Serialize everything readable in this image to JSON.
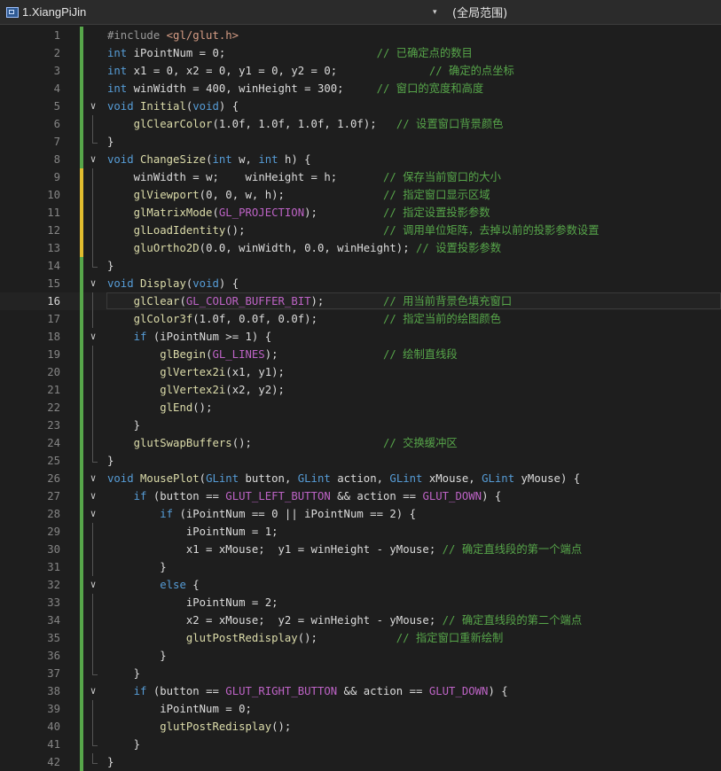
{
  "topbar": {
    "project": "1.XiangPiJin",
    "scope": "(全局范围)"
  },
  "editor": {
    "current_line": 16,
    "lines": [
      {
        "n": "1",
        "t": "#include <gl/glut.h>"
      },
      {
        "n": "2",
        "t": "int iPointNum = 0;                       // 已确定点的数目"
      },
      {
        "n": "3",
        "t": "int x1 = 0, x2 = 0, y1 = 0, y2 = 0;              // 确定的点坐标"
      },
      {
        "n": "4",
        "t": "int winWidth = 400, winHeight = 300;     // 窗口的宽度和高度"
      },
      {
        "n": "5",
        "t": "void Initial(void) {"
      },
      {
        "n": "6",
        "t": "    glClearColor(1.0f, 1.0f, 1.0f, 1.0f);   // 设置窗口背景颜色"
      },
      {
        "n": "7",
        "t": "}"
      },
      {
        "n": "8",
        "t": "void ChangeSize(int w, int h) {"
      },
      {
        "n": "9",
        "t": "    winWidth = w;    winHeight = h;       // 保存当前窗口的大小"
      },
      {
        "n": "10",
        "t": "    glViewport(0, 0, w, h);               // 指定窗口显示区域"
      },
      {
        "n": "11",
        "t": "    glMatrixMode(GL_PROJECTION);          // 指定设置投影参数"
      },
      {
        "n": "12",
        "t": "    glLoadIdentity();                     // 调用单位矩阵，去掉以前的投影参数设置"
      },
      {
        "n": "13",
        "t": "    gluOrtho2D(0.0, winWidth, 0.0, winHeight); // 设置投影参数"
      },
      {
        "n": "14",
        "t": "}"
      },
      {
        "n": "15",
        "t": "void Display(void) {"
      },
      {
        "n": "16",
        "t": "    glClear(GL_COLOR_BUFFER_BIT);         // 用当前背景色填充窗口"
      },
      {
        "n": "17",
        "t": "    glColor3f(1.0f, 0.0f, 0.0f);          // 指定当前的绘图颜色"
      },
      {
        "n": "18",
        "t": "    if (iPointNum >= 1) {"
      },
      {
        "n": "19",
        "t": "        glBegin(GL_LINES);                // 绘制直线段"
      },
      {
        "n": "20",
        "t": "        glVertex2i(x1, y1);"
      },
      {
        "n": "21",
        "t": "        glVertex2i(x2, y2);"
      },
      {
        "n": "22",
        "t": "        glEnd();"
      },
      {
        "n": "23",
        "t": "    }"
      },
      {
        "n": "24",
        "t": "    glutSwapBuffers();                    // 交换缓冲区"
      },
      {
        "n": "25",
        "t": "}"
      },
      {
        "n": "26",
        "t": "void MousePlot(GLint button, GLint action, GLint xMouse, GLint yMouse) {"
      },
      {
        "n": "27",
        "t": "    if (button == GLUT_LEFT_BUTTON && action == GLUT_DOWN) {"
      },
      {
        "n": "28",
        "t": "        if (iPointNum == 0 || iPointNum == 2) {"
      },
      {
        "n": "29",
        "t": "            iPointNum = 1;"
      },
      {
        "n": "30",
        "t": "            x1 = xMouse;  y1 = winHeight - yMouse; // 确定直线段的第一个端点"
      },
      {
        "n": "31",
        "t": "        }"
      },
      {
        "n": "32",
        "t": "        else {"
      },
      {
        "n": "33",
        "t": "            iPointNum = 2;"
      },
      {
        "n": "34",
        "t": "            x2 = xMouse;  y2 = winHeight - yMouse; // 确定直线段的第二个端点"
      },
      {
        "n": "35",
        "t": "            glutPostRedisplay();            // 指定窗口重新绘制"
      },
      {
        "n": "36",
        "t": "        }"
      },
      {
        "n": "37",
        "t": "    }"
      },
      {
        "n": "38",
        "t": "    if (button == GLUT_RIGHT_BUTTON && action == GLUT_DOWN) {"
      },
      {
        "n": "39",
        "t": "        iPointNum = 0;"
      },
      {
        "n": "40",
        "t": "        glutPostRedisplay();"
      },
      {
        "n": "41",
        "t": "    }"
      },
      {
        "n": "42",
        "t": "}"
      }
    ]
  },
  "colors": {
    "background": "#1e1e1e",
    "keyword": "#569cd6",
    "function": "#dcdcaa",
    "comment": "#57a64a",
    "macro": "#bd63c5",
    "string": "#d69d85",
    "change_saved": "#57a64a",
    "change_unsaved": "#e1bd2f"
  }
}
